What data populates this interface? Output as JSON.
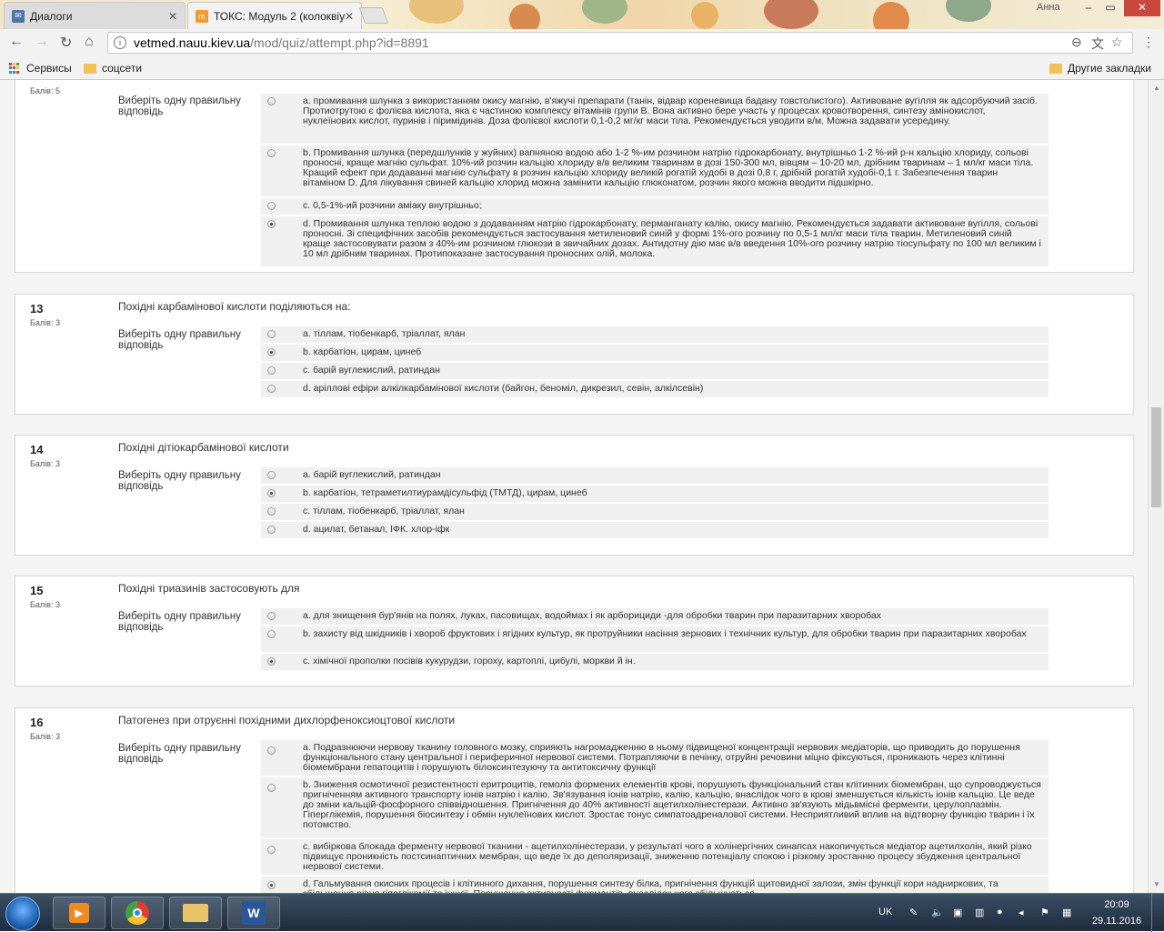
{
  "browser": {
    "tabs": [
      {
        "label": "Диалоги",
        "icon": "chat-icon"
      },
      {
        "label": "ТОКС: Модуль 2 (колоквіум)",
        "icon": "moodle-icon"
      }
    ],
    "user": "Анна",
    "url_domain": "vetmed.nauu.kiev.ua",
    "url_path": "/mod/quiz/attempt.php?id=8891",
    "bookmarks": {
      "apps": "Сервисы",
      "folder1": "соцсети",
      "other": "Другие закладки"
    }
  },
  "questions": [
    {
      "number": "",
      "grade": "Балів: 5",
      "text": "",
      "prompt": "Виберіть одну правильну відповідь",
      "answers": [
        {
          "text": "a. промивання шлунка з використанням окису магнію, в'яжучі препарати (танін, відвар кореневища бадану товстолистого). Активоване вугілля як адсорбуючий засіб. Протиотрутою є фолієва кислота, яка є частиною комплексу вітамінів групи В. Вона активно бере участь у процесах кровотворення, синтезу амінокислот, нуклеїнових кислот, пуринів і піримідинів. Доза фолієвої кислоти 0,1-0,2 мг/кг маси тіла. Рекомендується уводити в/м. Можна задавати усередину.",
          "selected": false
        },
        {
          "text": "b. Промивання шлунка (передшлунків у жуйних) вапняною водою або 1-2 %-им розчином натрію гідрокарбонату, внутрішньо 1-2 %-ий р-н кальцію хлориду, сольові проносні, краще магнію сульфат. 10%-ий розчин кальцію хлориду в/в великим тваринам в дозі 150-300 мл, вівцям – 10-20 мл, дрібним тваринам – 1 мл/кг маси тіла. Кращий ефект при додаванні магнію сульфату в розчин кальцію хлориду великій рогатій худобі в дозі 0,8 г, дрібній рогатій худобі-0,1 г. Забезпечення тварин вітаміном D. Для лікування свиней кальцію хлорид можна замінити кальцію глюконатом, розчин якого можна вводити підшкірно.",
          "selected": false
        },
        {
          "text": "c. 0,5-1%-ий розчини аміаку внутрішньо;",
          "selected": false
        },
        {
          "text": "d. Промивання шлунка теплою водою з додаванням натрію гідрокарбонату, перманганату калію, окису магнію. Рекомендується задавати активоване вугілля, сольові проносні. Зі специфічних засобів рекомендується застосування метиленовий синій у формі 1%-ого розчину по 0,5-1 мл/кг маси тіла тварин. Метиленовий синій краще застосовувати разом з 40%-им розчином глюкози в звичайних дозах. Антидотну дію має в/в введення 10%-ого розчину натрію тіосульфату по 100 мл великим і 10 мл дрібним тваринах. Протипоказане застосування проносних олій, молока.",
          "selected": true
        }
      ]
    },
    {
      "number": "13",
      "grade": "Балів: 3",
      "text": "Похідні карбамінової кислоти поділяються на:",
      "prompt": "Виберіть одну правильну відповідь",
      "answers": [
        {
          "text": "a. тіллам, тіобенкарб, тріаллат, ялан",
          "selected": false
        },
        {
          "text": "b. карбатіон, цирам, цинеб",
          "selected": true
        },
        {
          "text": "c. барій вуглекислий, ратиндан",
          "selected": false
        },
        {
          "text": "d. аріллові ефіри алкілкарбамінової кислоти (байгон, беноміл, дикрезил, севін, алкілсевін)",
          "selected": false
        }
      ]
    },
    {
      "number": "14",
      "grade": "Балів: 3",
      "text": "Похідні дітіокарбамінової кислоти",
      "prompt": "Виберіть одну правильну відповідь",
      "answers": [
        {
          "text": "a. барій вуглекислий, ратиндан",
          "selected": false
        },
        {
          "text": "b. карбатіон, тетраметилтиурамдісульфід (ТМТД), цирам, цинеб",
          "selected": true
        },
        {
          "text": "c. тіллам, тіобенкарб, тріаллат, ялан",
          "selected": false
        },
        {
          "text": "d. ацилат, бетанал, ІФК. хлор-іфк",
          "selected": false
        }
      ]
    },
    {
      "number": "15",
      "grade": "Балів: 3",
      "text": "Похідні триазинів застосовують для",
      "prompt": "Виберіть одну правильну відповідь",
      "answers": [
        {
          "text": "a. для знищення бур'янів на полях, луках, пасовищах, водоймах і як арборициди -для обробки тварин при паразитарних хворобах",
          "selected": false
        },
        {
          "text": "b. захисту від шкідників і хвороб фруктових і ягідних культур, як протруйники насіння зернових і технічних культур, для обробки тварин при паразитарних хворобах",
          "selected": false
        },
        {
          "text": "c. хімічної прополки посівів кукурудзи, гороху, картоплі, цибулі, моркви й ін.",
          "selected": true
        }
      ]
    },
    {
      "number": "16",
      "grade": "Балів: 3",
      "text": "Патогенез при отруєнні похідними дихлорфеноксиоцтової кислоти",
      "prompt": "Виберіть одну правильну відповідь",
      "answers": [
        {
          "text": "a. Подразнюючи нервову тканину головного мозку, сприяють нагромадженню в ньому підвищеної концентрації нервових медіаторів, що приводить до порушення функціонального стану центральної і периферичної нервової системи. Потрапляючи в печінку, отруйні речовини міцно фіксуються, проникають через клітинні біомембрани гепатоцитів і порушують білоксинтезуючу та антитоксичну функції",
          "selected": false
        },
        {
          "text": "b. Зниження осмотичної резистентності еритроцитів, гемоліз формених елементів крові, порушують функціональний стан клітинних біомембран, що супроводжується пригніченням активного транспорту іонів натрію і калію. Зв'язування іонів натрію, калію, кальцію, внаслідок чого в крові зменшується кількість іонів кальцію. Це веде до зміни кальцій-фосфорного співвідношення. Пригнічення до 40% активності ацетилхолінестерази. Активно зв'язують мідьвмісні ферменти, церулоплазмін. Гіперглікемія, порушення біосинтезу і обмін нуклеїнових кислот. Зростає тонус симпатоадреналової системи. Несприятливий вплив на відтворну функцію тварин і їх потомство.",
          "selected": false
        },
        {
          "text": "c. вибіркова блокада ферменту нервової тканини - ацетилхолінестерази, у результаті чого в холінергічних синапсах накопичується медіатор ацетилхолін, який різко підвищує проникність постсинаптичних мембран, що веде їх до деполяризації, зниженню потенціалу спокою і різкому зростанню процесу збудження центральної нервової системи.",
          "selected": false
        },
        {
          "text": "d. Гальмування окисних процесів і клітинного дихання, порушення синтезу білка, пригнічення функцій щитовидної залози, змін функції кори надниркових, та збільшення рівня гіпоглікемії та іншої. Порушення активності ферментів, внаслідок чого збільшується...",
          "selected": true
        }
      ]
    }
  ],
  "taskbar": {
    "lang": "UK",
    "time": "20:09",
    "date": "29.11.2016"
  }
}
